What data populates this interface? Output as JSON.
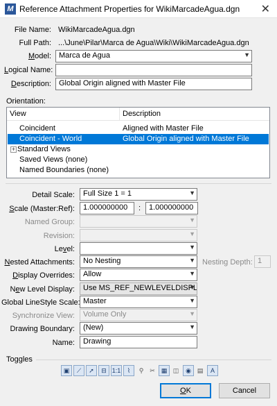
{
  "window": {
    "title": "Reference Attachment Properties for WikiMarcadeAgua.dgn",
    "close_glyph": "✕"
  },
  "file": {
    "file_name_label": "File Name:",
    "file_name": "WikiMarcadeAgua.dgn",
    "full_path_label": "Full Path:",
    "full_path": "...\\June\\Pilar\\Marca de Agua\\Wiki\\WikiMarcadeAgua.dgn",
    "model_label": "Model:",
    "model": "Marca de Agua",
    "logical_name_label": "Logical Name:",
    "logical_name": "",
    "description_label": "Description:",
    "description": "Global Origin aligned with Master File"
  },
  "orientation": {
    "label": "Orientation:",
    "columns": [
      "View",
      "Description"
    ],
    "rows": [
      {
        "view": "Coincident",
        "description": "Aligned with Master File",
        "selected": false
      },
      {
        "view": "Coincident - World",
        "description": "Global Origin aligned with Master File",
        "selected": true
      },
      {
        "view": "Standard Views",
        "description": "",
        "expander": "+"
      },
      {
        "view": "Saved Views (none)",
        "description": ""
      },
      {
        "view": "Named Boundaries (none)",
        "description": ""
      }
    ]
  },
  "settings": {
    "detail_scale_label": "Detail Scale:",
    "detail_scale": "Full Size 1 = 1",
    "scale_label": "Scale (Master:Ref):",
    "scale_master": "1.000000000",
    "scale_colon": ":",
    "scale_ref": "1.000000000",
    "named_group_label": "Named Group:",
    "named_group": "",
    "revision_label": "Revision:",
    "revision": "",
    "level_label": "Level:",
    "level": "",
    "nested_label": "Nested Attachments:",
    "nested": "No Nesting",
    "nesting_depth_label": "Nesting Depth:",
    "nesting_depth": "1",
    "display_overrides_label": "Display Overrides:",
    "display_overrides": "Allow",
    "new_level_display_label": "New Level Display:",
    "new_level_display": "Use MS_REF_NEWLEVELDISPLAY Co",
    "global_linestyle_label": "Global LineStyle Scale:",
    "global_linestyle": "Master",
    "synchronize_view_label": "Synchronize View:",
    "synchronize_view": "Volume Only",
    "drawing_boundary_label": "Drawing Boundary:",
    "drawing_boundary": "(New)",
    "name_label": "Name:",
    "name": "Drawing"
  },
  "toggles": {
    "label": "Toggles",
    "icons": [
      "display-icon",
      "snap-icon",
      "locate-icon",
      "lock-icon",
      "scale-linestyles-icon",
      "true-scale-icon",
      "ignore-attachment-icon",
      "clip-icon",
      "raster-icon",
      "treat-as-element-icon",
      "light-icon",
      "annotation-icon",
      "level-icon"
    ]
  },
  "buttons": {
    "ok": "OK",
    "cancel": "Cancel"
  }
}
